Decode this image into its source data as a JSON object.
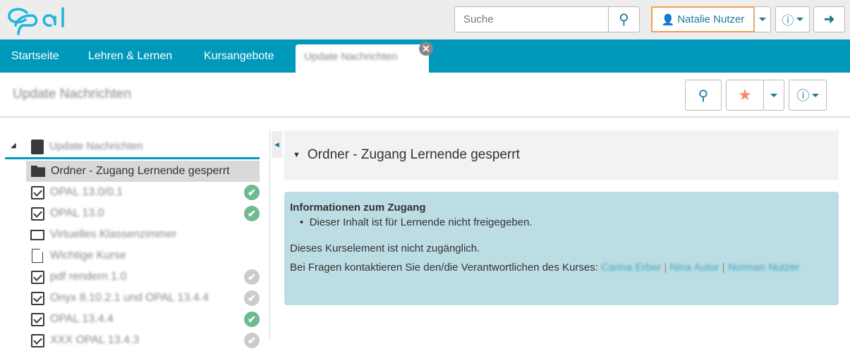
{
  "header": {
    "logo": "opal",
    "search_placeholder": "Suche",
    "user_name": "Natalie Nutzer"
  },
  "nav": {
    "items": [
      "Startseite",
      "Lehren & Lernen",
      "Kursangebote"
    ],
    "active_tab": "Update Nachrichten"
  },
  "page": {
    "title": "Update Nachrichten"
  },
  "tree": {
    "root": "Update Nachrichten",
    "selected": "Ordner - Zugang Lernende gesperrt",
    "items": [
      {
        "label": "OPAL 13.0/0.1",
        "icon": "checkbox",
        "status": "done"
      },
      {
        "label": "OPAL 13.0",
        "icon": "checkbox",
        "status": "done"
      },
      {
        "label": "Virtuelles Klassenzimmer",
        "icon": "monitor",
        "status": ""
      },
      {
        "label": "Wichtige Kurse",
        "icon": "page",
        "status": ""
      },
      {
        "label": "pdf rendern 1.0",
        "icon": "checkbox",
        "status": "pending"
      },
      {
        "label": "Onyx 8.10.2.1 und OPAL 13.4.4",
        "icon": "checkbox",
        "status": "pending"
      },
      {
        "label": "OPAL 13.4.4",
        "icon": "checkbox",
        "status": "done"
      },
      {
        "label": "XXX OPAL 13.4.3",
        "icon": "checkbox",
        "status": "pending"
      }
    ]
  },
  "content": {
    "heading": "Ordner - Zugang Lernende gesperrt",
    "info_title": "Informationen zum Zugang",
    "bullet": "Dieser Inhalt ist für Lernende nicht freigegeben.",
    "line1": "Dieses Kurselement ist nicht zugänglich.",
    "line2": "Bei Fragen kontaktieren Sie den/die Verantwortlichen des Kurses:",
    "contacts": [
      "Carina Erber",
      "Nina Autor",
      "Norman Nutzer"
    ]
  },
  "colors": {
    "brand": "#0099bb",
    "done": "#6fba8f",
    "pending": "#cccccc",
    "star": "#f58a6b",
    "focus": "#f0a050"
  }
}
